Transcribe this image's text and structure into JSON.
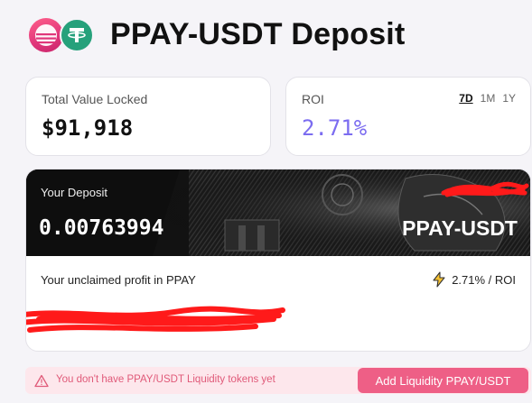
{
  "header": {
    "title": "PPAY-USDT Deposit",
    "logos": [
      "ppay-logo",
      "usdt-logo"
    ]
  },
  "tvl": {
    "label": "Total Value Locked",
    "value": "$91,918"
  },
  "roi": {
    "label": "ROI",
    "value": "2.71%",
    "periods": [
      "7D",
      "1M",
      "1Y"
    ],
    "active_period": "7D"
  },
  "deposit": {
    "label": "Your Deposit",
    "amount": "0.00763994",
    "pair": "PPAY-USDT"
  },
  "profit": {
    "label": "Your unclaimed profit in PPAY",
    "roi_text": "2.71% / ROI"
  },
  "alert": {
    "text": "You don't have PPAY/USDT Liquidity tokens yet",
    "button_label": "Add Liquidity PPAY/USDT"
  },
  "colors": {
    "accent": "#7b6cf0",
    "button": "#ee5f86",
    "alert_bg": "#fde7ec",
    "alert_text": "#e05a79",
    "redaction": "#ff0000"
  }
}
